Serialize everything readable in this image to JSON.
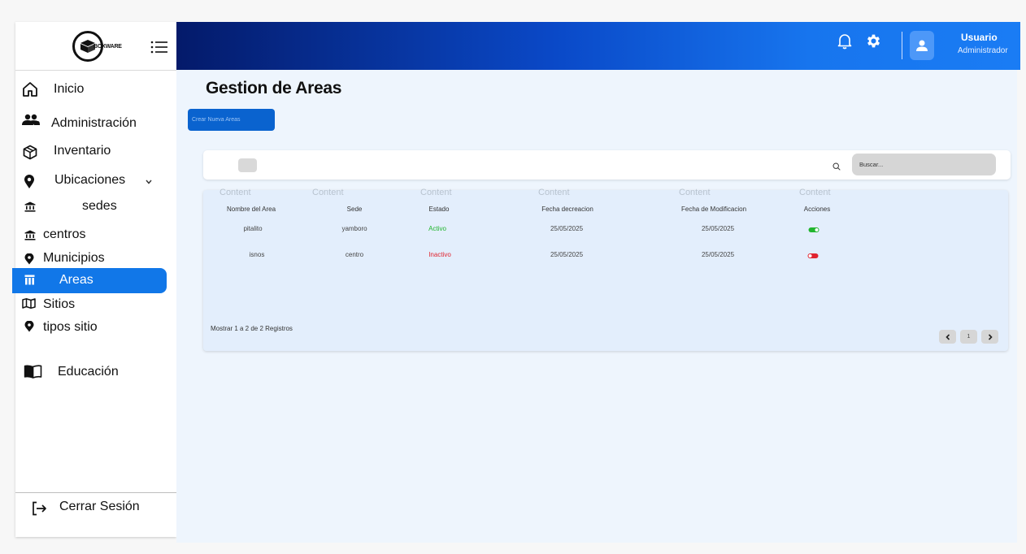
{
  "brand": {
    "logo_text": "BOXWARE"
  },
  "sidebar": {
    "items": [
      {
        "label": "Inicio"
      },
      {
        "label": "Administración"
      },
      {
        "label": "Inventario"
      },
      {
        "label": "Ubicaciones"
      },
      {
        "label": "sedes"
      },
      {
        "label": "centros"
      },
      {
        "label": "Municipios"
      },
      {
        "label": "Areas",
        "active": true
      },
      {
        "label": "Sitios"
      },
      {
        "label": "tipos sitio"
      },
      {
        "label": "Educación"
      }
    ],
    "logout_label": "Cerrar Sesión"
  },
  "header": {
    "user_name": "Usuario",
    "user_role": "Administrador"
  },
  "main": {
    "title": "Gestion de Areas",
    "create_button": "Crear Nueva Areas",
    "search_placeholder": "Buscar...",
    "content_placeholder": "Content",
    "columns": [
      "Nombre del Area",
      "Sede",
      "Estado",
      "Fecha decreacion",
      "Fecha de Modificacion",
      "Acciones"
    ],
    "rows": [
      {
        "nombre": "pitalito",
        "sede": "yamboro",
        "estado": "Activo",
        "fecha_creacion": "25/05/2025",
        "fecha_modificacion": "25/05/2025",
        "toggle_on": true
      },
      {
        "nombre": "isnos",
        "sede": "centro",
        "estado": "Inactivo",
        "fecha_creacion": "25/05/2025",
        "fecha_modificacion": "25/05/2025",
        "toggle_on": false
      }
    ],
    "footer_text": "Mostrar 1 a 2 de 2 Registros",
    "current_page": "1"
  },
  "colors": {
    "accent": "#1177e8",
    "active_status": "#21b52e",
    "inactive_status": "#e0242f"
  }
}
